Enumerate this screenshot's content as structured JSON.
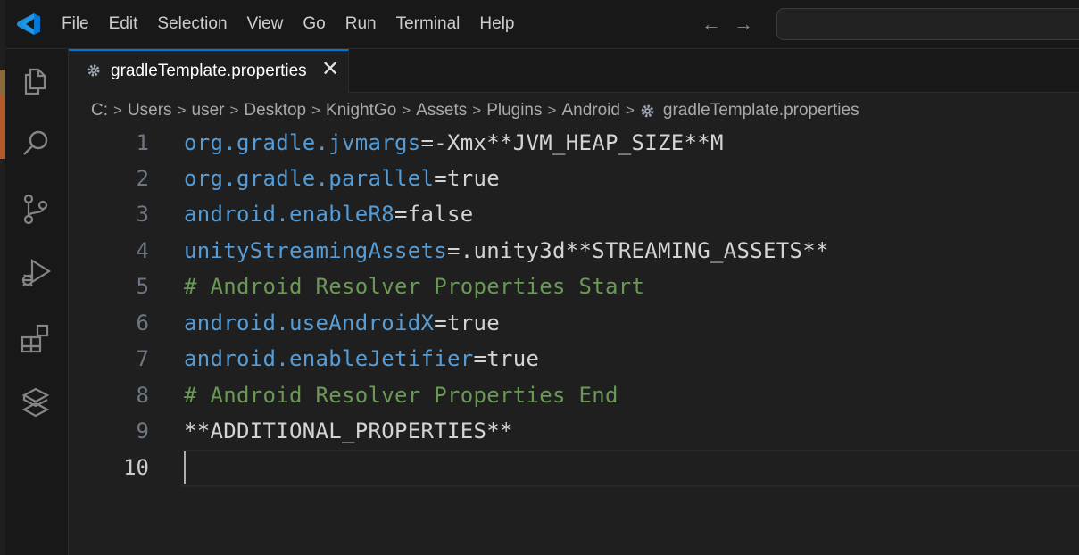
{
  "menu": [
    "File",
    "Edit",
    "Selection",
    "View",
    "Go",
    "Run",
    "Terminal",
    "Help"
  ],
  "nav": {
    "back": "←",
    "forward": "→"
  },
  "activity_bar": [
    "explorer-icon",
    "search-icon",
    "source-control-icon",
    "run-debug-icon",
    "extensions-icon",
    "remote-icon"
  ],
  "tab": {
    "label": "gradleTemplate.properties",
    "close": "✕"
  },
  "breadcrumb": [
    "C:",
    "Users",
    "user",
    "Desktop",
    "KnightGo",
    "Assets",
    "Plugins",
    "Android",
    "gradleTemplate.properties"
  ],
  "editor": {
    "lines": [
      {
        "num": "1",
        "key": "org.gradle.jvmargs",
        "eq": "=",
        "value": "-Xmx**JVM_HEAP_SIZE**M"
      },
      {
        "num": "2",
        "key": "org.gradle.parallel",
        "eq": "=",
        "value": "true"
      },
      {
        "num": "3",
        "key": "android.enableR8",
        "eq": "=",
        "value": "false"
      },
      {
        "num": "4",
        "key": "unityStreamingAssets",
        "eq": "=",
        "value": ".unity3d**STREAMING_ASSETS**"
      },
      {
        "num": "5",
        "comment": "# Android Resolver Properties Start"
      },
      {
        "num": "6",
        "key": "android.useAndroidX",
        "eq": "=",
        "value": "true"
      },
      {
        "num": "7",
        "key": "android.enableJetifier",
        "eq": "=",
        "value": "true"
      },
      {
        "num": "8",
        "comment": "# Android Resolver Properties End"
      },
      {
        "num": "9",
        "plain": "**ADDITIONAL_PROPERTIES**"
      },
      {
        "num": "10",
        "plain": ""
      }
    ]
  },
  "colors": {
    "accent": "#0078d4",
    "key": "#569cd6",
    "value": "#d4d4d4",
    "comment": "#6a9955"
  }
}
